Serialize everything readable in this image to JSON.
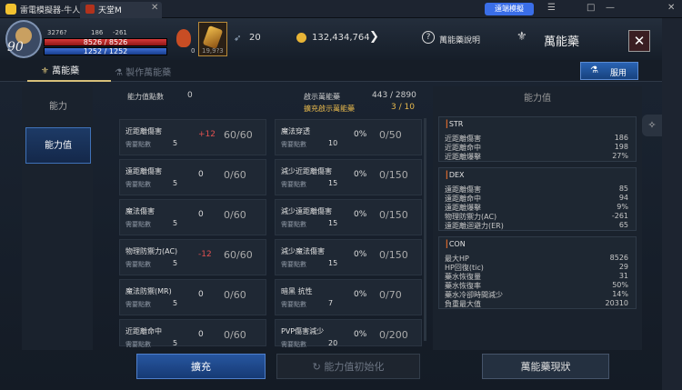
{
  "emulator": {
    "title": "雷電模擬器-牛人",
    "tab_label": "天堂M",
    "mode_label": "遠端模擬",
    "controls": [
      "☰",
      "□",
      "—",
      "✕"
    ]
  },
  "hud": {
    "level": "90",
    "small_stats": [
      "3276?",
      "186",
      "-261"
    ],
    "hp": "8526 / 8526",
    "mp": "1252 / 1252",
    "potion_count": "0",
    "slot_count": "19,9?3",
    "feather_count": "20",
    "gold": "132,434,764",
    "help_label": "萬能藥說明",
    "screen_title": "萬能藥",
    "close": "✕"
  },
  "tabs": {
    "active": "萬能藥",
    "inactive": "製作萬能藥",
    "use_button": "服用"
  },
  "left_menu": [
    "能力",
    "能力值"
  ],
  "counters": {
    "points_label": "能力值點數",
    "points_value": "0",
    "total_label": "啟示萬能藥",
    "total_value": "443 / 2890",
    "expand_label": "擴充啟示萬能藥",
    "expand_value": "3 / 10"
  },
  "cells": [
    {
      "name": "近距離傷害",
      "req": "需要點數",
      "pts": "5",
      "bonus": "+12",
      "bonus_color": "#e05050",
      "prog": "60/60"
    },
    {
      "name": "魔法穿透",
      "req": "需要點數",
      "pts": "10",
      "bonus": "0%",
      "bonus_color": "#dddddd",
      "prog": "0/50"
    },
    {
      "name": "遠距離傷害",
      "req": "需要點數",
      "pts": "5",
      "bonus": "0",
      "bonus_color": "#dddddd",
      "prog": "0/60"
    },
    {
      "name": "減少近距離傷害",
      "req": "需要點數",
      "pts": "15",
      "bonus": "0%",
      "bonus_color": "#dddddd",
      "prog": "0/150"
    },
    {
      "name": "魔法傷害",
      "req": "需要點數",
      "pts": "5",
      "bonus": "0",
      "bonus_color": "#dddddd",
      "prog": "0/60"
    },
    {
      "name": "減少遠距離傷害",
      "req": "需要點數",
      "pts": "15",
      "bonus": "0%",
      "bonus_color": "#dddddd",
      "prog": "0/150"
    },
    {
      "name": "物理防禦力(AC)",
      "req": "需要點數",
      "pts": "5",
      "bonus": "-12",
      "bonus_color": "#e05050",
      "prog": "60/60"
    },
    {
      "name": "減少魔法傷害",
      "req": "需要點數",
      "pts": "15",
      "bonus": "0%",
      "bonus_color": "#dddddd",
      "prog": "0/150"
    },
    {
      "name": "魔法防禦(MR)",
      "req": "需要點數",
      "pts": "5",
      "bonus": "0",
      "bonus_color": "#dddddd",
      "prog": "0/60"
    },
    {
      "name": "暗黑 抗性",
      "req": "需要點數",
      "pts": "7",
      "bonus": "0%",
      "bonus_color": "#dddddd",
      "prog": "0/70"
    },
    {
      "name": "近距離命中",
      "req": "需要點數",
      "pts": "5",
      "bonus": "0",
      "bonus_color": "#dddddd",
      "prog": "0/60"
    },
    {
      "name": "PVP傷害減少",
      "req": "需要點數",
      "pts": "20",
      "bonus": "0%",
      "bonus_color": "#dddddd",
      "prog": "0/200"
    }
  ],
  "right_panel": {
    "title": "能力值",
    "sections": [
      {
        "head": "STR",
        "rows": [
          [
            "近距離傷害",
            "186"
          ],
          [
            "近距離命中",
            "198"
          ],
          [
            "近距離爆擊",
            "27%"
          ]
        ]
      },
      {
        "head": "DEX",
        "rows": [
          [
            "遠距離傷害",
            "85"
          ],
          [
            "遠距離命中",
            "94"
          ],
          [
            "遠距離爆擊",
            "9%"
          ],
          [
            "物理防禦力(AC)",
            "-261"
          ],
          [
            "遠距離迴避力(ER)",
            "65"
          ]
        ]
      },
      {
        "head": "CON",
        "rows": [
          [
            "最大HP",
            "8526"
          ],
          [
            "HP回復(tic)",
            "29"
          ],
          [
            "藥水恢復量",
            "31"
          ],
          [
            "藥水恢復率",
            "50%"
          ],
          [
            "藥水冷卻時間減少",
            "14%"
          ],
          [
            "負重最大值",
            "20310"
          ]
        ]
      }
    ]
  },
  "bottom": {
    "expand": "擴充",
    "reset": "能力值初始化",
    "reset_icon": "↻",
    "status": "萬能藥現狀"
  }
}
